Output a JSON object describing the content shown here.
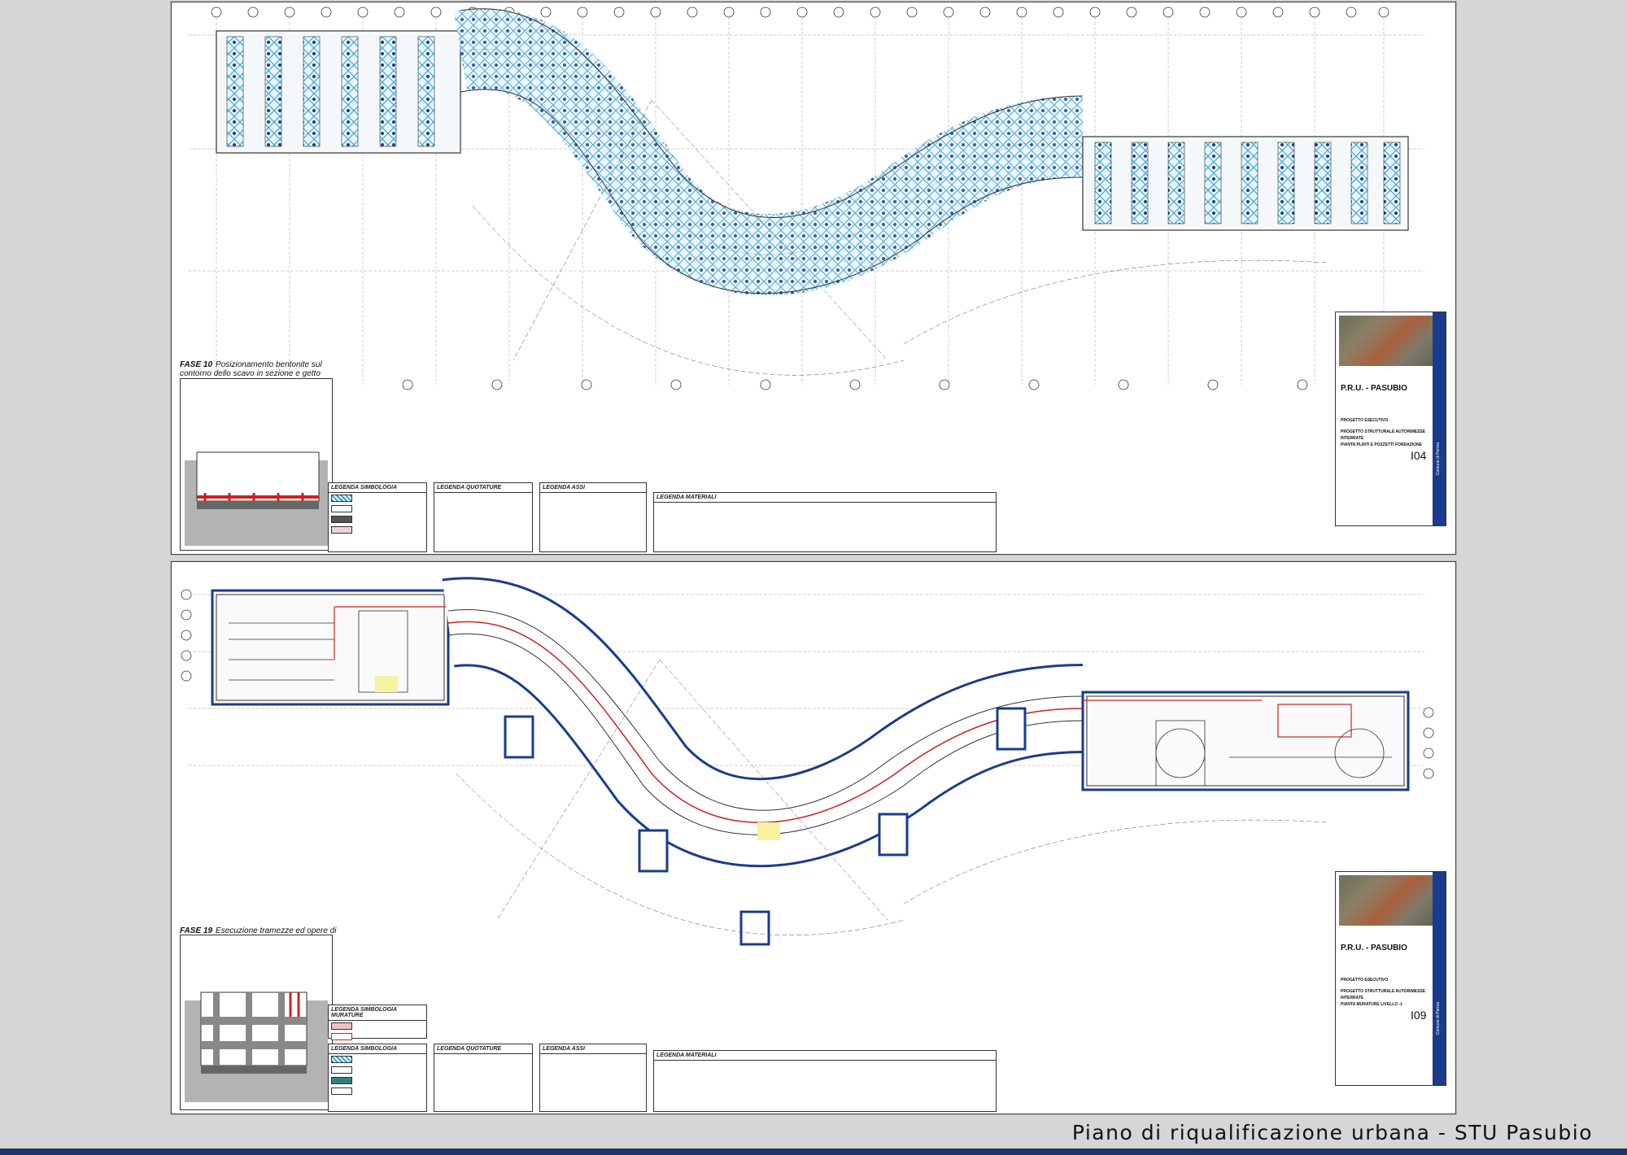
{
  "caption": "Piano di riqualificazione urbana - STU Pasubio",
  "colors": {
    "blue_band": "#1b3c8c",
    "bottom_bar": "#1d3566",
    "plan_line": "#333333",
    "accent_cyan": "#2a9fd0",
    "accent_red": "#d02020"
  },
  "sheets": [
    {
      "phase": "FASE 10",
      "phase_text": "Posizionamento bentonite sul contorno dello scavo in sezione e getto fondazioni",
      "legends": {
        "simbologia": "LEGENDA SIMBOLOGIA",
        "quotature": "LEGENDA QUOTATURE",
        "assi": "LEGENDA ASSI",
        "materiali": "LEGENDA MATERIALI"
      },
      "title_block": {
        "title": "P.R.U. - PASUBIO",
        "phase": "PROGETTO ESECUTIVO",
        "desc_1": "PROGETTO STRUTTURALE AUTORIMESSE INTERRATE",
        "desc_2": "PIANTA PLINTI E POZZETTI FONDAZIONE",
        "code": "I04",
        "side": "Comune di Parma"
      }
    },
    {
      "phase": "FASE 19",
      "phase_text": "Esecuzione tramezze ed opere di finiture",
      "legends": {
        "simbologia_murature": "LEGENDA SIMBOLOGIA MURATURE",
        "simbologia": "LEGENDA SIMBOLOGIA",
        "quotature": "LEGENDA QUOTATURE",
        "assi": "LEGENDA ASSI",
        "materiali": "LEGENDA MATERIALI"
      },
      "title_block": {
        "title": "P.R.U. - PASUBIO",
        "phase": "PROGETTO ESECUTIVO",
        "desc_1": "PROGETTO STRUTTURALE AUTORIMESSE INTERRATE",
        "desc_2": "PIANTA MURATURE LIVELLO -1",
        "code": "I09",
        "side": "Comune di Parma"
      }
    }
  ]
}
